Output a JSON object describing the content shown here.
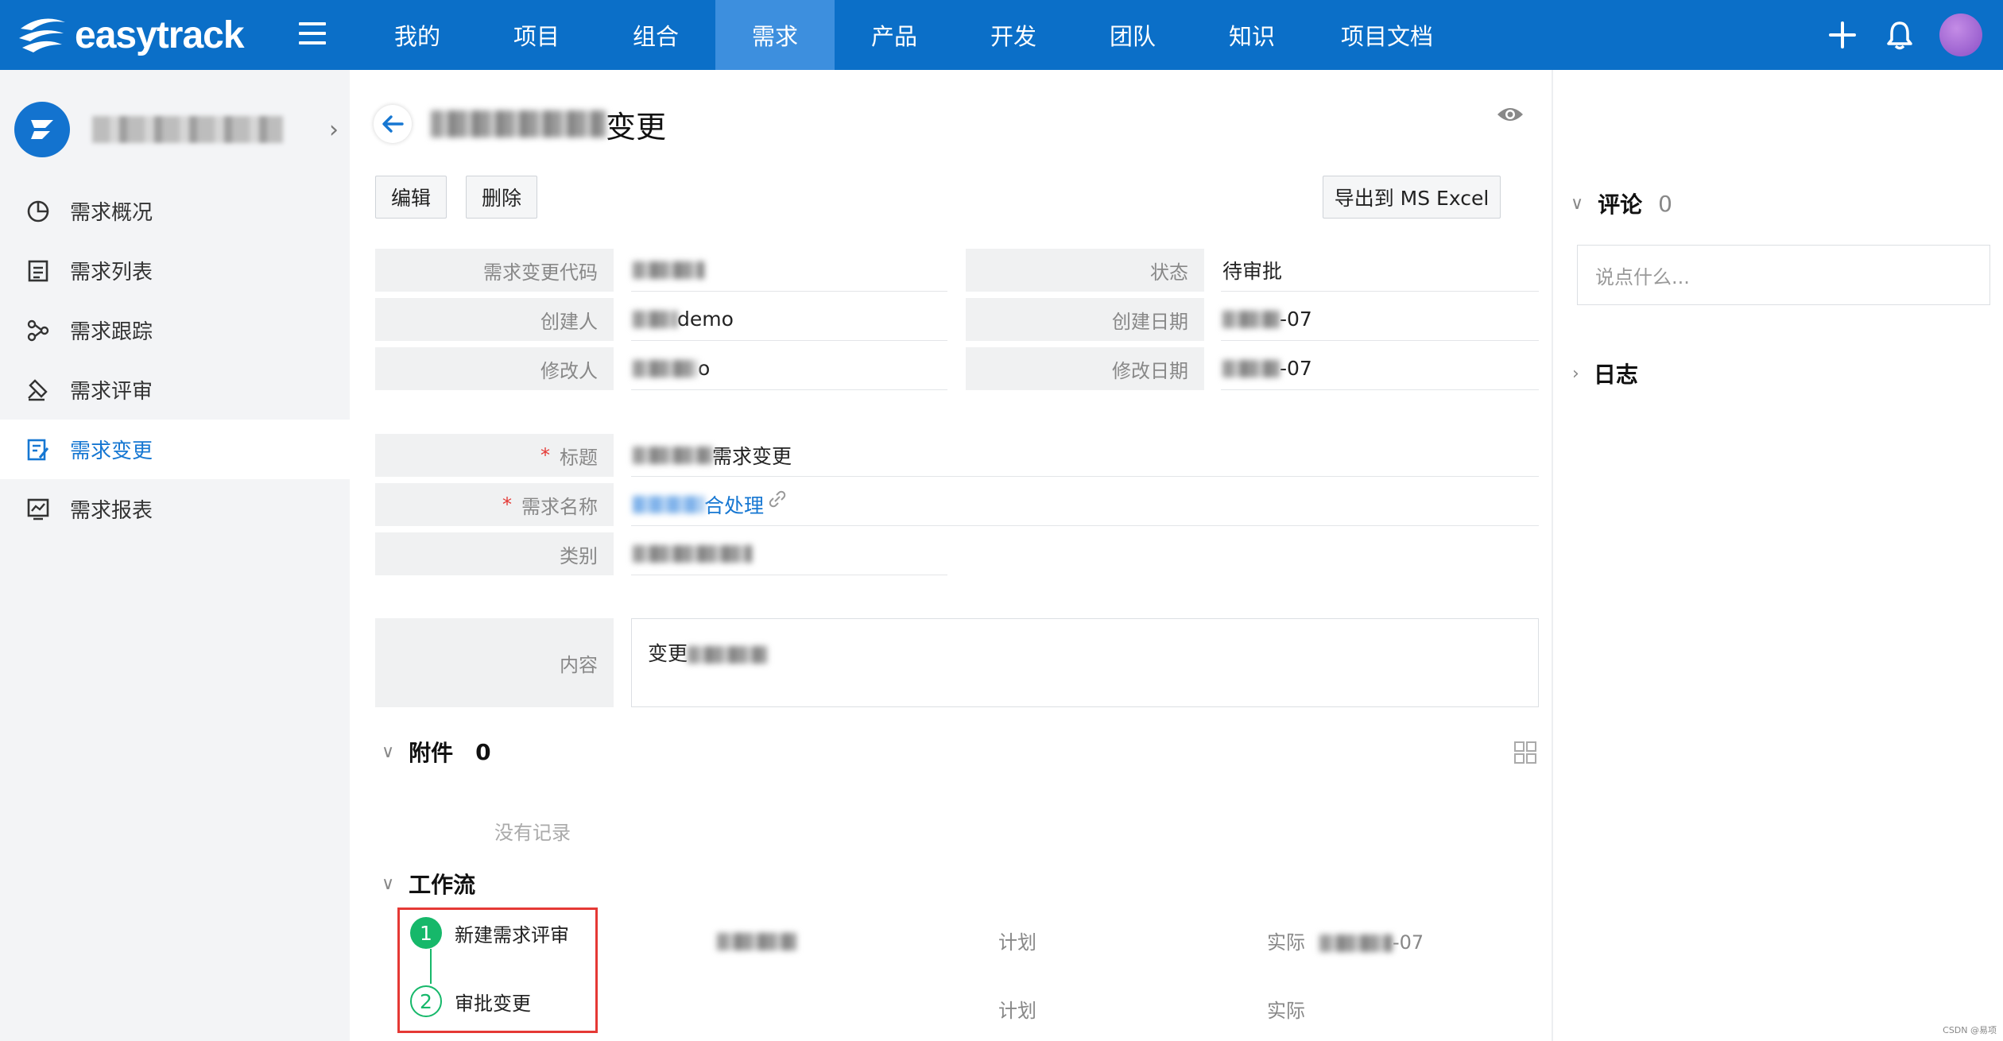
{
  "brand": {
    "name": "easytrack"
  },
  "nav": {
    "items": [
      "我的",
      "项目",
      "组合",
      "需求",
      "产品",
      "开发",
      "团队",
      "知识",
      "项目文档"
    ],
    "active_index": 3
  },
  "topbar": {
    "add_icon": "plus-icon",
    "notify_icon": "bell-icon"
  },
  "sidebar": {
    "items": [
      {
        "label": "需求概况",
        "icon": "pie-chart-icon"
      },
      {
        "label": "需求列表",
        "icon": "list-icon"
      },
      {
        "label": "需求跟踪",
        "icon": "trace-icon"
      },
      {
        "label": "需求评审",
        "icon": "gavel-icon"
      },
      {
        "label": "需求变更",
        "icon": "edit-doc-icon"
      },
      {
        "label": "需求报表",
        "icon": "line-chart-icon"
      }
    ],
    "active_index": 4
  },
  "page": {
    "title_suffix": "变更"
  },
  "toolbar": {
    "edit": "编辑",
    "delete": "删除",
    "export": "导出到 MS Excel"
  },
  "fields": {
    "code_label": "需求变更代码",
    "status_label": "状态",
    "status_value": "待审批",
    "creator_label": "创建人",
    "creator_value_suffix": "demo",
    "created_date_label": "创建日期",
    "created_date_suffix": "-07",
    "modifier_label": "修改人",
    "modifier_value_suffix": "o",
    "modified_date_label": "修改日期",
    "modified_date_suffix": "-07",
    "title_label": "标题",
    "title_value_suffix": "需求变更",
    "req_name_label": "需求名称",
    "req_name_value_suffix": "合处理",
    "category_label": "类别",
    "content_label": "内容",
    "content_value_prefix": "变更"
  },
  "attachments": {
    "title": "附件",
    "count": "0",
    "empty": "没有记录"
  },
  "workflow": {
    "title": "工作流",
    "steps": [
      {
        "num": "1",
        "name": "新建需求评审",
        "plan_label": "计划",
        "actual_label": "实际",
        "actual_suffix": "-07"
      },
      {
        "num": "2",
        "name": "审批变更",
        "plan_label": "计划",
        "actual_label": "实际",
        "actual_suffix": ""
      }
    ]
  },
  "comments": {
    "title": "评论",
    "count": "0",
    "placeholder": "说点什么..."
  },
  "log": {
    "title": "日志"
  },
  "watermark": "CSDN @易项",
  "colors": {
    "primary": "#0b6fc8",
    "nav_active": "#3d8fde",
    "accent": "#1677d2",
    "highlight": "#e53935",
    "step": "#16b86a"
  }
}
